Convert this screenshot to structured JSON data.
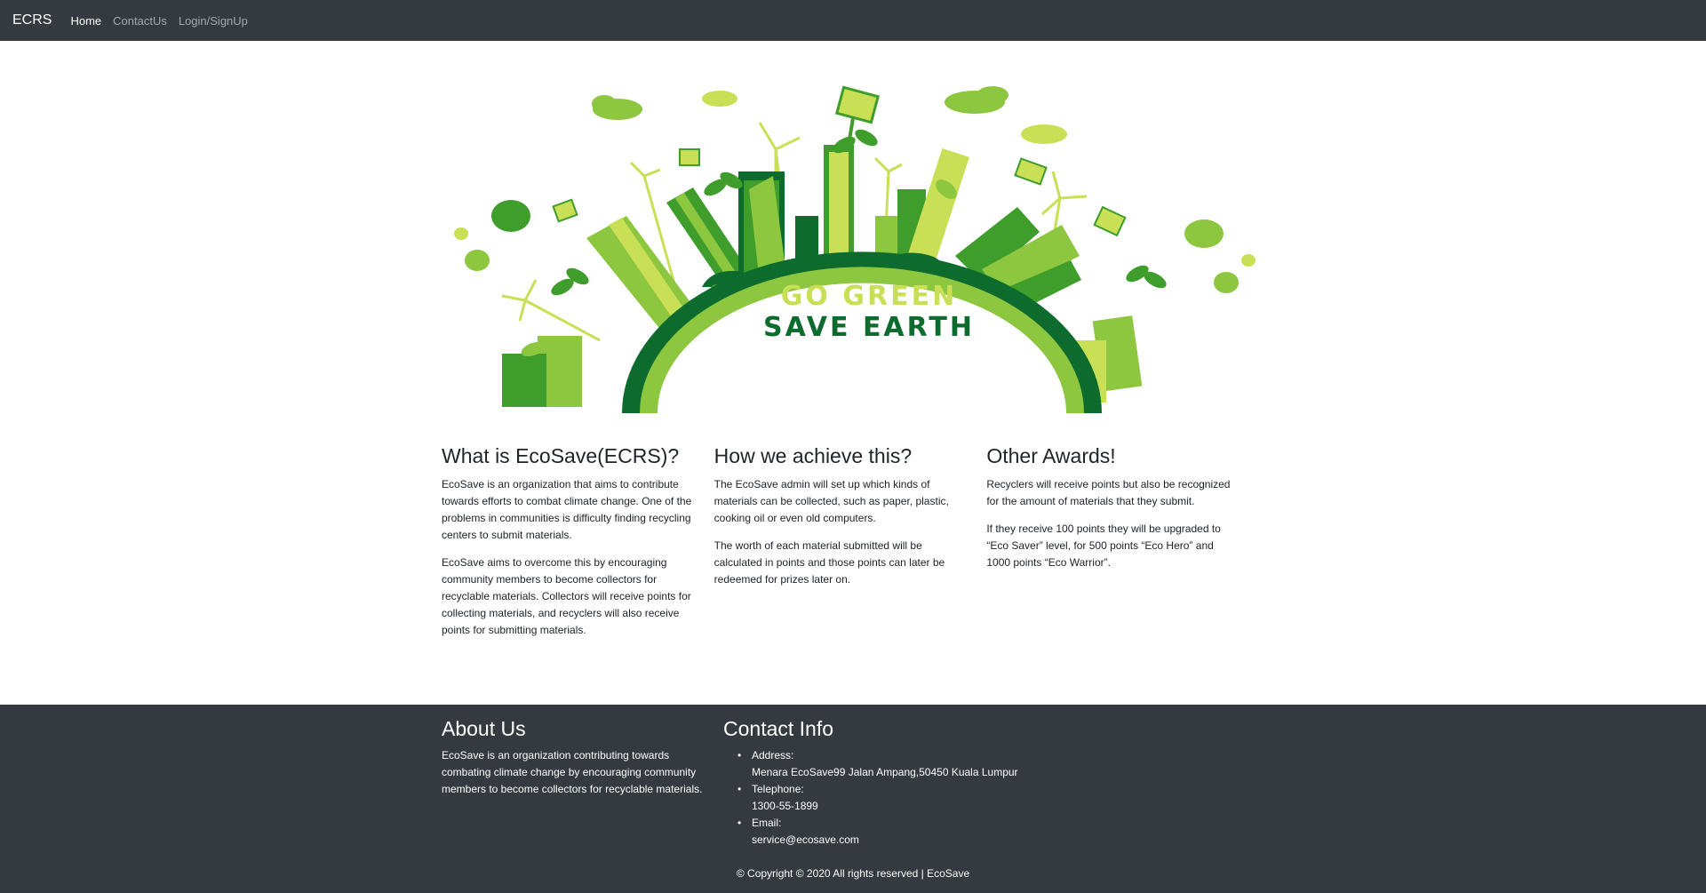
{
  "nav": {
    "brand": "ECRS",
    "links": [
      "Home",
      "ContactUs",
      "Login/SignUp"
    ]
  },
  "hero": {
    "line1": "GO GREEN",
    "line2": "SAVE EARTH",
    "colors": {
      "dark_green": "#0d6b2e",
      "mid_green": "#3f9e2b",
      "light_green": "#8dc63f",
      "lime": "#c9df55"
    }
  },
  "features": [
    {
      "title": "What is EcoSave(ECRS)?",
      "paragraphs": [
        "EcoSave is an organization that aims to contribute towards efforts to combat climate change. One of the problems in communities is difficulty finding recycling centers to submit materials.",
        "EcoSave aims to overcome this by encouraging community members to become collectors for recyclable materials. Collectors will receive points for collecting materials, and recyclers will also receive points for submitting materials."
      ]
    },
    {
      "title": "How we achieve this?",
      "paragraphs": [
        "The EcoSave admin will set up which kinds of materials can be collected, such as paper, plastic, cooking oil or even old computers.",
        "The worth of each material submitted will be calculated in points and those points can later be redeemed for prizes later on."
      ]
    },
    {
      "title": "Other Awards!",
      "paragraphs": [
        "Recyclers will receive points but also be recognized for the amount of materials that they submit.",
        "If they receive 100 points they will be upgraded to “Eco Saver” level, for 500 points “Eco Hero” and 1000 points “Eco Warrior”."
      ]
    }
  ],
  "footer": {
    "about_title": "About Us",
    "about_text": "EcoSave is an organization contributing towards combating climate change by encouraging community members to become collectors for recyclable materials.",
    "contact_title": "Contact Info",
    "contact": [
      {
        "label": "Address:",
        "value": "Menara EcoSave99 Jalan Ampang,50450 Kuala Lumpur"
      },
      {
        "label": "Telephone:",
        "value": "1300-55-1899"
      },
      {
        "label": "Email:",
        "value": "service@ecosave.com"
      }
    ],
    "copyright": "© Copyright © 2020 All rights reserved | EcoSave"
  }
}
